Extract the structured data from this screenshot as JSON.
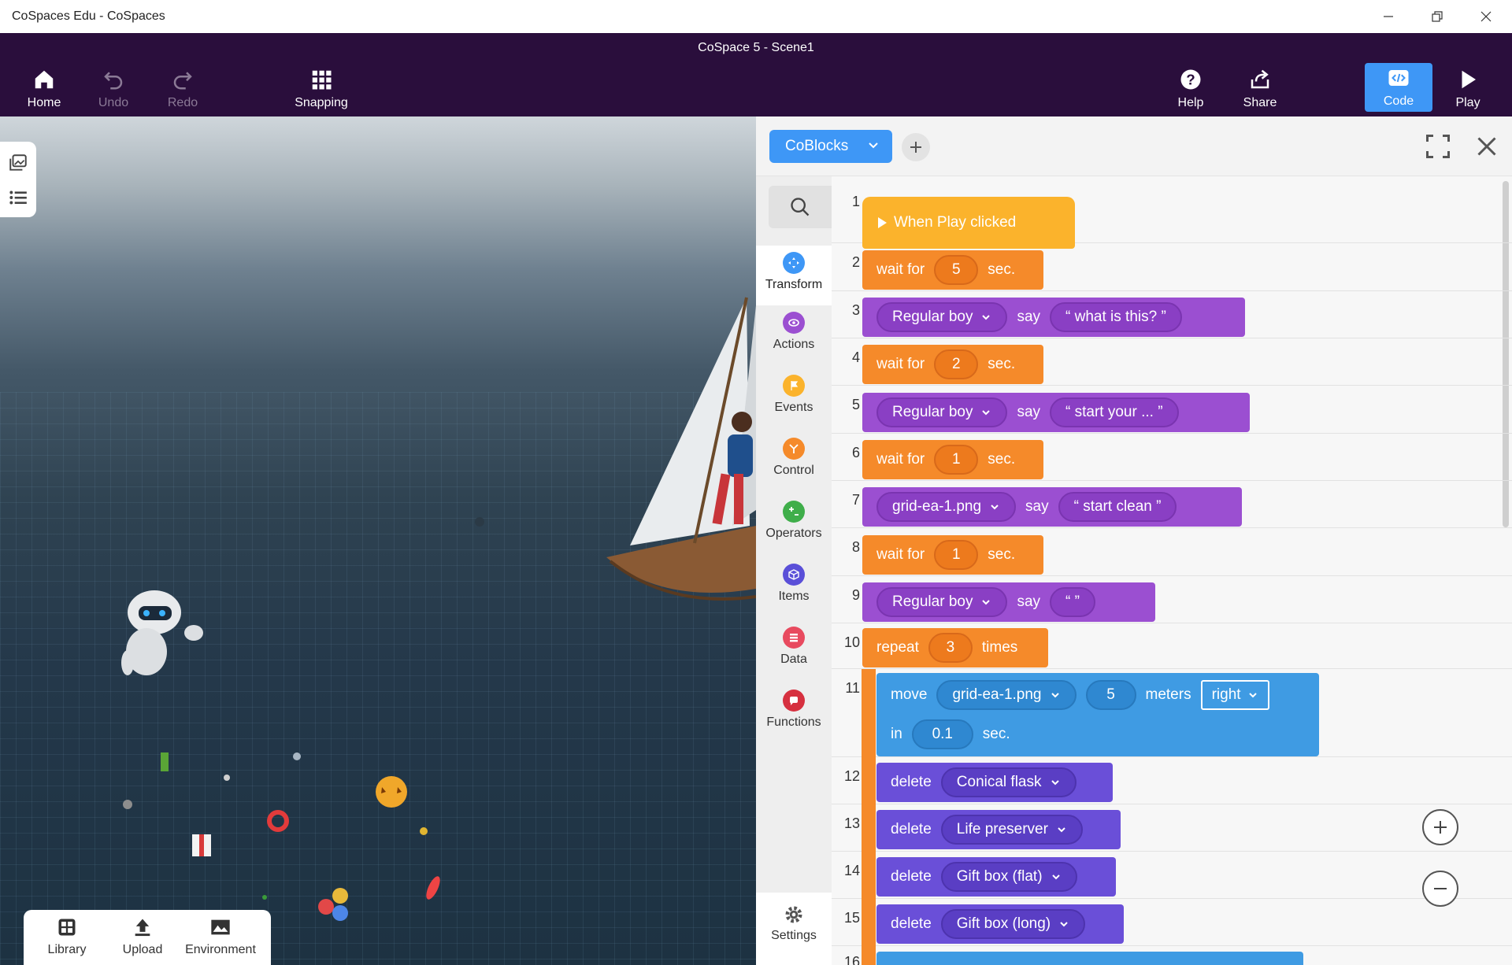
{
  "window": {
    "title": "CoSpaces Edu - CoSpaces"
  },
  "toolbar": {
    "doc_title": "CoSpace 5 - Scene1",
    "home": "Home",
    "undo": "Undo",
    "redo": "Redo",
    "snapping": "Snapping",
    "help": "Help",
    "share": "Share",
    "code": "Code",
    "play": "Play"
  },
  "scene_tray": {
    "library": "Library",
    "upload": "Upload",
    "environment": "Environment"
  },
  "code_panel": {
    "editor_type": "CoBlocks",
    "categories": [
      "Transform",
      "Actions",
      "Events",
      "Control",
      "Operators",
      "Items",
      "Data",
      "Functions"
    ],
    "settings": "Settings"
  },
  "script": {
    "line_numbers": [
      "1",
      "2",
      "3",
      "4",
      "5",
      "6",
      "7",
      "8",
      "9",
      "10",
      "11",
      "12",
      "13",
      "14",
      "15",
      "16"
    ],
    "l1": {
      "label": "When Play clicked"
    },
    "l2": {
      "kw": "wait for",
      "val": "5",
      "unit": "sec."
    },
    "l3": {
      "item": "Regular boy",
      "kw": "say",
      "text": "“  what is this?  ”"
    },
    "l4": {
      "kw": "wait for",
      "val": "2",
      "unit": "sec."
    },
    "l5": {
      "item": "Regular boy",
      "kw": "say",
      "text": "“  start your ...   ”"
    },
    "l6": {
      "kw": "wait for",
      "val": "1",
      "unit": "sec."
    },
    "l7": {
      "item": "grid-ea-1.png",
      "kw": "say",
      "text": "“  start clean  ”"
    },
    "l8": {
      "kw": "wait for",
      "val": "1",
      "unit": "sec."
    },
    "l9": {
      "item": "Regular boy",
      "kw": "say",
      "text": "“   ”"
    },
    "l10": {
      "kw": "repeat",
      "val": "3",
      "unit": "times"
    },
    "l11": {
      "kw": "move",
      "item": "grid-ea-1.png",
      "val": "5",
      "unit": "meters",
      "dir": "right",
      "in": "in",
      "time": "0.1",
      "sec": "sec."
    },
    "l12": {
      "kw": "delete",
      "item": "Conical flask"
    },
    "l13": {
      "kw": "delete",
      "item": "Life preserver"
    },
    "l14": {
      "kw": "delete",
      "item": "Gift box (flat)"
    },
    "l15": {
      "kw": "delete",
      "item": "Gift box (long)"
    }
  },
  "colors": {
    "toolbar_bg": "#2a0e3c",
    "accent_blue": "#3e97f6",
    "block_orange": "#f58a2a",
    "block_yellow": "#fbb32c",
    "block_purple": "#9b4fd1",
    "block_violet": "#6a4fd8",
    "block_blue": "#3f9be3"
  },
  "icons": [
    "home-icon",
    "undo-icon",
    "redo-icon",
    "grid-icon",
    "help-icon",
    "share-icon",
    "code-icon",
    "play-icon",
    "search-icon",
    "expand-icon",
    "close-icon",
    "plus-icon",
    "minus-icon",
    "gear-icon"
  ]
}
